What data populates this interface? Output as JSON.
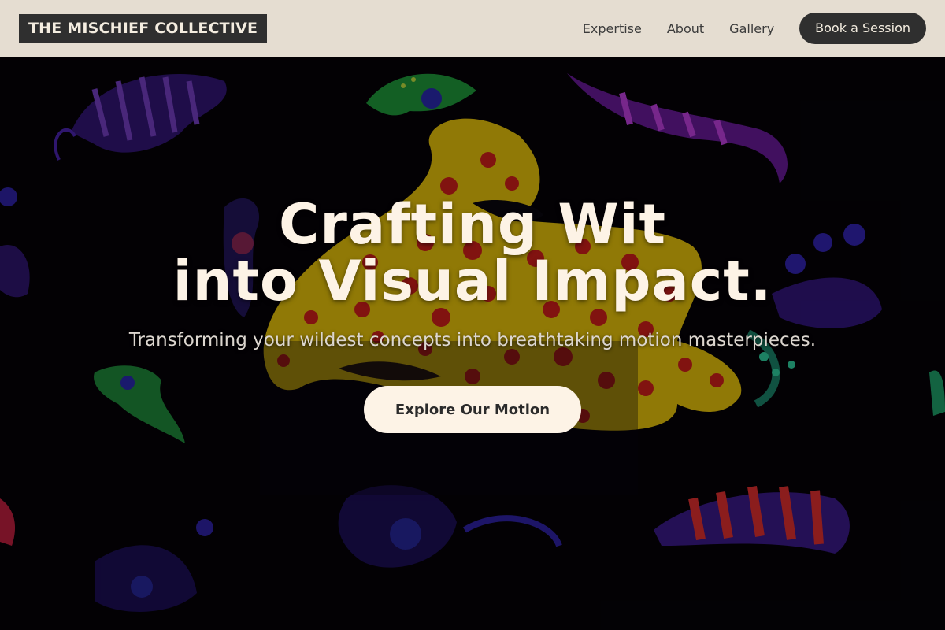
{
  "nav": {
    "logo": "THE MISCHIEF COLLECTIVE",
    "links": [
      "Expertise",
      "About",
      "Gallery"
    ],
    "cta": "Book a Session"
  },
  "hero": {
    "headline_line1": "Crafting Wit",
    "headline_line2": "into Visual Impact.",
    "subheading": "Transforming your wildest concepts into breathtaking motion masterpieces.",
    "button": "Explore Our Motion"
  },
  "colors": {
    "nav_bg": "#e5ddd1",
    "dark": "#2f2f2f",
    "cream": "#fdf3e6"
  }
}
